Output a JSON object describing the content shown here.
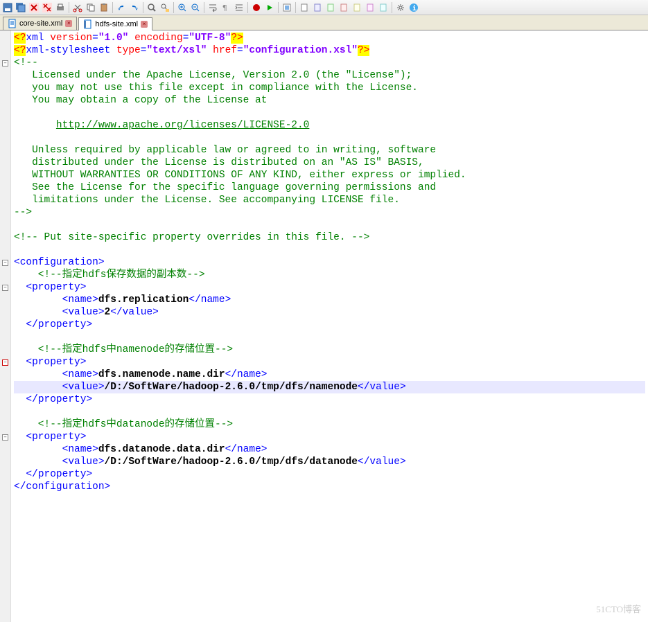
{
  "toolbar": {
    "icons": [
      "save",
      "save-all",
      "close",
      "close-all",
      "print",
      "sep",
      "cut",
      "copy",
      "paste",
      "sep",
      "undo",
      "redo",
      "sep",
      "find",
      "replace",
      "sep",
      "zoom-in",
      "zoom-out",
      "sep",
      "wrap",
      "show-ws",
      "indent",
      "sep",
      "macro-rec",
      "macro-play",
      "sep",
      "func-list",
      "sep",
      "doc1",
      "doc2",
      "doc3",
      "doc4",
      "doc5",
      "doc6",
      "doc7",
      "sep",
      "settings",
      "info"
    ]
  },
  "tabs": [
    {
      "name": "core-site.xml",
      "active": false
    },
    {
      "name": "hdfs-site.xml",
      "active": true
    }
  ],
  "code": {
    "l1a": "<?",
    "l1b": "xml ",
    "l1c": "version",
    "l1d": "=",
    "l1e": "\"1.0\"",
    "l1f": " ",
    "l1g": "encoding",
    "l1h": "=",
    "l1i": "\"UTF-8\"",
    "l1j": "?>",
    "l2a": "<?",
    "l2b": "xml-stylesheet ",
    "l2c": "type",
    "l2d": "=",
    "l2e": "\"text/xsl\"",
    "l2f": " ",
    "l2g": "href",
    "l2h": "=",
    "l2i": "\"configuration.xsl\"",
    "l2j": "?>",
    "l3": "<!--",
    "l4": "   Licensed under the Apache License, Version 2.0 (the \"License\");",
    "l5": "   you may not use this file except in compliance with the License.",
    "l6": "   You may obtain a copy of the License at",
    "l7": "",
    "l8a": "       ",
    "l8b": "http://www.apache.org/licenses/LICENSE-2.0",
    "l9": "",
    "l10": "   Unless required by applicable law or agreed to in writing, software",
    "l11": "   distributed under the License is distributed on an \"AS IS\" BASIS,",
    "l12": "   WITHOUT WARRANTIES OR CONDITIONS OF ANY KIND, either express or implied.",
    "l13": "   See the License for the specific language governing permissions and",
    "l14": "   limitations under the License. See accompanying LICENSE file.",
    "l15": "-->",
    "l16": "",
    "l17": "<!-- Put site-specific property overrides in this file. -->",
    "l18": "",
    "l19a": "<",
    "l19b": "configuration",
    "l19c": ">",
    "l20": "    <!--指定hdfs保存数据的副本数-->",
    "l21a": "  <",
    "l21b": "property",
    "l21c": ">",
    "l22a": "        <",
    "l22b": "name",
    "l22c": ">",
    "l22d": "dfs.replication",
    "l22e": "</",
    "l22f": "name",
    "l22g": ">",
    "l23a": "        <",
    "l23b": "value",
    "l23c": ">",
    "l23d": "2",
    "l23e": "</",
    "l23f": "value",
    "l23g": ">",
    "l24a": "  </",
    "l24b": "property",
    "l24c": ">",
    "l25": "",
    "l26": "    <!--指定hdfs中namenode的存储位置-->",
    "l27a": "  <",
    "l27b": "property",
    "l27c": ">",
    "l28a": "        <",
    "l28b": "name",
    "l28c": ">",
    "l28d": "dfs.namenode.name.dir",
    "l28e": "</",
    "l28f": "name",
    "l28g": ">",
    "l29a": "        <",
    "l29b": "value",
    "l29c": ">",
    "l29d": "/D:/SoftWare/hadoop-2.6.0/tmp/dfs/namenode",
    "l29e": "</",
    "l29f": "value",
    "l29g": ">",
    "l30a": "  </",
    "l30b": "property",
    "l30c": ">",
    "l31": "",
    "l32": "    <!--指定hdfs中datanode的存储位置-->",
    "l33a": "  <",
    "l33b": "property",
    "l33c": ">",
    "l34a": "        <",
    "l34b": "name",
    "l34c": ">",
    "l34d": "dfs.datanode.data.dir",
    "l34e": "</",
    "l34f": "name",
    "l34g": ">",
    "l35a": "        <",
    "l35b": "value",
    "l35c": ">",
    "l35d": "/D:/SoftWare/hadoop-2.6.0/tmp/dfs/datanode",
    "l35e": "</",
    "l35f": "value",
    "l35g": ">",
    "l36a": "  </",
    "l36b": "property",
    "l36c": ">",
    "l37a": "</",
    "l37b": "configuration",
    "l37c": ">"
  },
  "watermark": "51CTO博客"
}
